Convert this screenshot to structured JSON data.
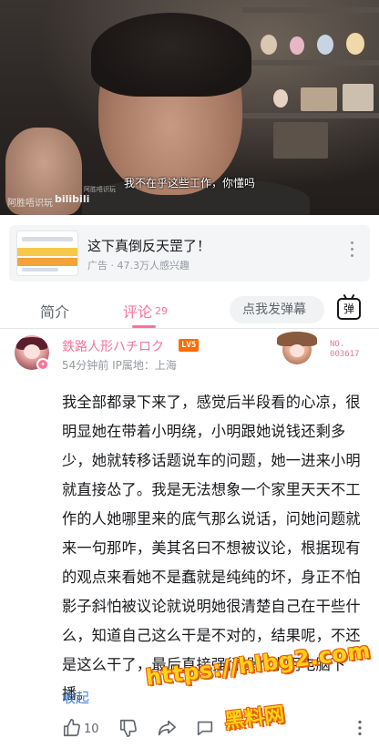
{
  "video": {
    "subtitle": "我不在乎这些工作，你懂吗",
    "watermark_left": "阿胜唔识玩",
    "watermark_logo": "bilibili",
    "watermark_small": "阿胜唔识玩"
  },
  "ad": {
    "title": "这下真倒反天罡了！",
    "meta": "广告 · 47.3万人感兴趣"
  },
  "tabs": {
    "intro_label": "简介",
    "comment_label": "评论",
    "comment_count": "29",
    "danmaku_placeholder": "点我发弹幕",
    "danmaku_toggle_label": "弹"
  },
  "comment": {
    "username": "鉄路人形ハチロク",
    "level": "LV5",
    "meta": "54分钟前  IP属地：上海",
    "fan_number_label": "NO.",
    "fan_number": "003617",
    "text": "我全部都录下来了，感觉后半段看的心凉，很明显她在带着小明绕，小明跟她说钱还剩多少，她就转移话题说车的问题，她一进来小明就直接怂了。我是无法想象一个家里天天不工作的人她哪里来的底气那么说话，问她问题就来一句那咋，美其名曰不想被议论，根据现有的观点来看她不是蠢就是纯纯的坏，身正不怕影子斜怕被议论就说明她很清楚自己在干些什么，知道自己这么干是不对的，结果呢，不还是这么干了，最后直接强行操作小明电脑下播。",
    "collapse_label": "收起",
    "like_count": "10"
  },
  "watermark": {
    "site": "https://hlbg2.com",
    "name": "黑料网"
  },
  "colors": {
    "accent": "#fb7299",
    "link": "#3f82d6",
    "level_badge": "#ff6c00"
  }
}
